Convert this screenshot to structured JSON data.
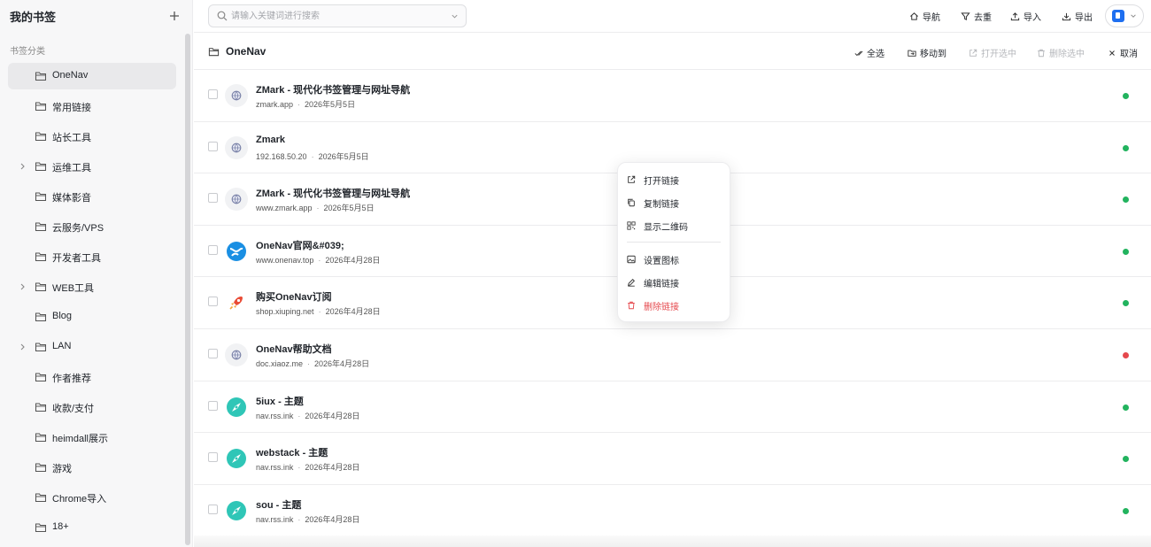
{
  "sidebar": {
    "title": "我的书签",
    "section_label": "书签分类",
    "items": [
      {
        "label": "OneNav",
        "expandable": false,
        "active": true
      },
      {
        "label": "常用链接",
        "expandable": false
      },
      {
        "label": "站长工具",
        "expandable": false
      },
      {
        "label": "运维工具",
        "expandable": true
      },
      {
        "label": "媒体影音",
        "expandable": false
      },
      {
        "label": "云服务/VPS",
        "expandable": false
      },
      {
        "label": "开发者工具",
        "expandable": false
      },
      {
        "label": "WEB工具",
        "expandable": true
      },
      {
        "label": "Blog",
        "expandable": false
      },
      {
        "label": "LAN",
        "expandable": true
      },
      {
        "label": "作者推荐",
        "expandable": false
      },
      {
        "label": "收款/支付",
        "expandable": false
      },
      {
        "label": "heimdall展示",
        "expandable": false
      },
      {
        "label": "游戏",
        "expandable": false
      },
      {
        "label": "Chrome导入",
        "expandable": false
      },
      {
        "label": "18+",
        "expandable": false
      }
    ]
  },
  "search": {
    "placeholder": "请输入关键词进行搜索",
    "value": ""
  },
  "toolbar": {
    "nav": "导航",
    "dedupe": "去重",
    "import": "导入",
    "export": "导出"
  },
  "folder": {
    "title": "OneNav",
    "select_all": "全选",
    "move_to": "移动到",
    "open_selected": "打开选中",
    "delete_selected": "删除选中",
    "cancel": "取消"
  },
  "bookmarks": [
    {
      "title": "ZMark - 现代化书签管理与网址导航",
      "domain": "zmark.app",
      "date": "2026年5月5日",
      "icon": "default-globe-icon",
      "status": "#22b35e"
    },
    {
      "title": "Zmark",
      "domain": "192.168.50.20",
      "date": "2026年5月5日",
      "icon": "default-globe-icon",
      "status": "#22b35e"
    },
    {
      "title": "ZMark - 现代化书签管理与网址导航",
      "domain": "www.zmark.app",
      "date": "2026年5月5日",
      "icon": "default-globe-icon",
      "status": "#22b35e"
    },
    {
      "title": "OneNav官网&#039;",
      "domain": "www.onenav.top",
      "date": "2026年4月28日",
      "icon": "onenav-logo-icon",
      "status": "#22b35e"
    },
    {
      "title": "购买OneNav订阅",
      "domain": "shop.xiuping.net",
      "date": "2026年4月28日",
      "icon": "rocket-icon",
      "status": "#22b35e"
    },
    {
      "title": "OneNav帮助文档",
      "domain": "doc.xiaoz.me",
      "date": "2026年4月28日",
      "icon": "default-globe-icon",
      "status": "#e5484d"
    },
    {
      "title": "5iux - 主题",
      "domain": "nav.rss.ink",
      "date": "2026年4月28日",
      "icon": "compass-icon",
      "status": "#22b35e"
    },
    {
      "title": "webstack - 主题",
      "domain": "nav.rss.ink",
      "date": "2026年4月28日",
      "icon": "compass-icon",
      "status": "#22b35e"
    },
    {
      "title": "sou - 主题",
      "domain": "nav.rss.ink",
      "date": "2026年4月28日",
      "icon": "compass-icon",
      "status": "#22b35e"
    }
  ],
  "context_menu": {
    "open_link": "打开链接",
    "copy_link": "复制链接",
    "show_qr": "显示二维码",
    "set_icon": "设置图标",
    "edit_link": "编辑链接",
    "delete_link": "删除链接"
  },
  "colors": {
    "accent": "#1e6ff0",
    "status_ok": "#22b35e",
    "status_error": "#e5484d",
    "danger": "#e5484d"
  }
}
